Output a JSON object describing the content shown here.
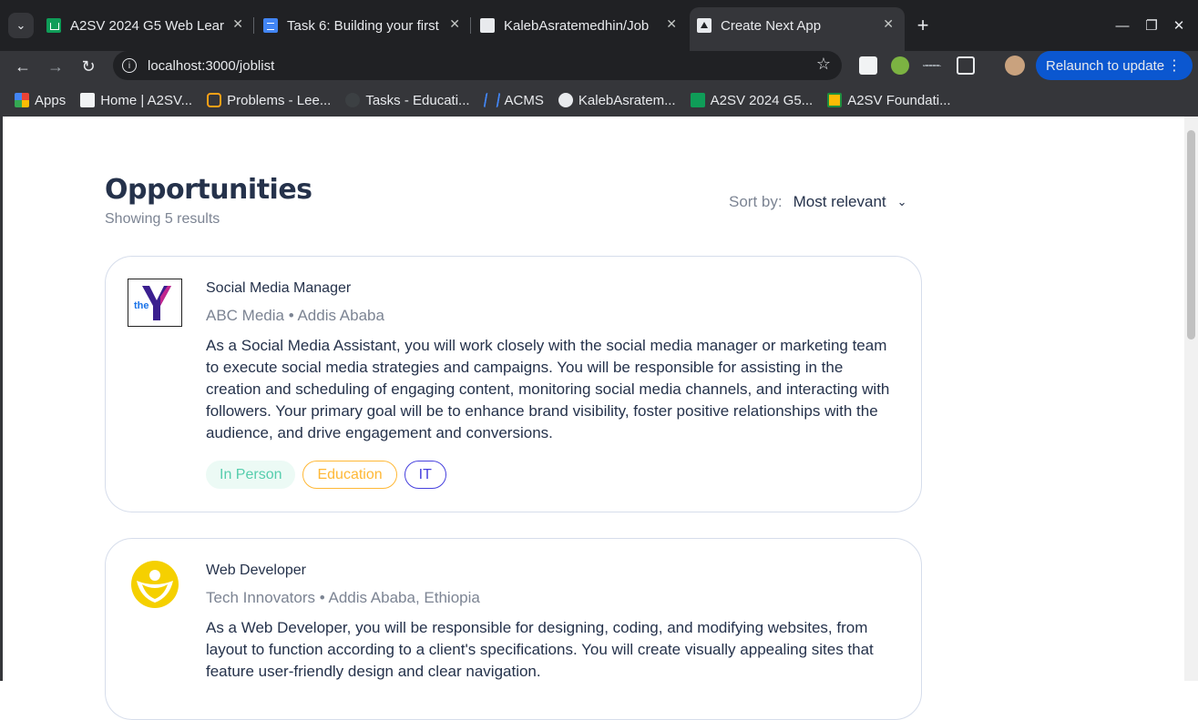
{
  "browser": {
    "tabs": [
      {
        "title": "A2SV 2024 G5 Web Lear",
        "icon": "google-sheets-icon"
      },
      {
        "title": "Task 6: Building your first",
        "icon": "google-docs-icon"
      },
      {
        "title": "KalebAsratemedhin/Job",
        "icon": "github-icon"
      },
      {
        "title": "Create Next App",
        "icon": "nextjs-icon",
        "active": true
      }
    ],
    "url": "localhost:3000/joblist",
    "relaunch_label": "Relaunch to update",
    "bookmarks": [
      {
        "label": "Apps",
        "icon": "apps-grid-icon"
      },
      {
        "label": "Home | A2SV...",
        "icon": "a2sv-icon"
      },
      {
        "label": "Problems - Lee...",
        "icon": "leetcode-icon"
      },
      {
        "label": "Tasks - Educati...",
        "icon": "tasks-icon"
      },
      {
        "label": "ACMS",
        "icon": "acms-icon"
      },
      {
        "label": "KalebAsratem...",
        "icon": "github-icon"
      },
      {
        "label": "A2SV 2024 G5...",
        "icon": "google-sheets-icon"
      },
      {
        "label": "A2SV Foundati...",
        "icon": "google-classroom-icon"
      }
    ]
  },
  "page": {
    "title": "Opportunities",
    "subtitle": "Showing 5 results",
    "sort_label": "Sort by:",
    "sort_value": "Most relevant"
  },
  "jobs": [
    {
      "title": "Social Media Manager",
      "company": "ABC Media",
      "location": "Addis Ababa",
      "description": "As a Social Media Assistant, you will work closely with the social media manager or marketing team to execute social media strategies and campaigns. You will be responsible for assisting in the creation and scheduling of engaging content, monitoring social media channels, and interacting with followers. Your primary goal will be to enhance brand visibility, foster positive relationships with the audience, and drive engagement and conversions.",
      "tags": [
        "In Person",
        "Education",
        "IT"
      ],
      "logo_text": "the"
    },
    {
      "title": "Web Developer",
      "company": "Tech Innovators",
      "location": "Addis Ababa, Ethiopia",
      "description": "As a Web Developer, you will be responsible for designing, coding, and modifying websites, from layout to function according to a client's specifications. You will create visually appealing sites that feature user-friendly design and clear navigation."
    }
  ],
  "separator": "•",
  "colors": {
    "heading": "#25324b",
    "muted": "#7c8493",
    "tag_green": "#56cdad",
    "tag_orange": "#ffb836",
    "tag_indigo": "#4640de",
    "card_border": "#d6ddeb"
  }
}
